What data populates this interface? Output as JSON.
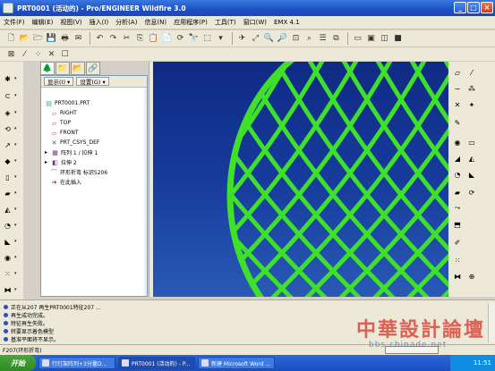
{
  "window": {
    "title": "PRT0001 (活动的) - Pro/ENGINEER Wildfire 3.0",
    "buttons": [
      "minimize",
      "maximize",
      "close"
    ]
  },
  "menu": [
    "文件(F)",
    "编辑(E)",
    "视图(V)",
    "插入(I)",
    "分析(A)",
    "信息(N)",
    "应用程序(P)",
    "工具(T)",
    "窗口(W)",
    "EMX 4.1"
  ],
  "navigator": {
    "show_button": "显示(I) ▾",
    "settings_button": "设置(G) ▾",
    "tree": [
      {
        "label": "PRT0001.PRT",
        "icon": "part-icon",
        "level": 0
      },
      {
        "label": "RIGHT",
        "icon": "datum-plane-icon",
        "level": 1
      },
      {
        "label": "TOP",
        "icon": "datum-plane-icon",
        "level": 1
      },
      {
        "label": "FRONT",
        "icon": "datum-plane-icon",
        "level": 1
      },
      {
        "label": "PRT_CSYS_DEF",
        "icon": "csys-icon",
        "level": 1
      },
      {
        "label": "阵列 1 / 拉伸 1",
        "icon": "pattern-icon",
        "level": 1,
        "expandable": true
      },
      {
        "label": "拉伸 2",
        "icon": "extrude-icon",
        "level": 1,
        "expandable": true
      },
      {
        "label": "环形折弯 标识5206",
        "icon": "toroidal-bend-icon",
        "level": 1
      },
      {
        "label": "在此插入",
        "icon": "insert-here-icon",
        "level": 1
      }
    ]
  },
  "messages": [
    {
      "text": "正在从207 再生PRT0001特征207 ...",
      "color": "#2a4fc0"
    },
    {
      "text": "再生成功完成。",
      "color": "#2a4fc0"
    },
    {
      "text": "特征再生失败。",
      "color": "#2a4fc0"
    },
    {
      "text": "转要显示着色模型",
      "color": "#2a4fc0"
    },
    {
      "text": "基准平面将不显示。",
      "color": "#2a4fc0"
    }
  ],
  "status_text": "F207(环形折弯)",
  "watermark": {
    "main": "中華設計論壇",
    "sub": "bbs.chinade.net"
  },
  "taskbar": {
    "start": "开始",
    "tasks": [
      {
        "label": "行灯架阵列+3分量D...",
        "active": false
      },
      {
        "label": "PRT0001 (活动的) - P...",
        "active": true
      },
      {
        "label": "新建 Microsoft Word ...",
        "active": false
      }
    ],
    "clock": "11:51"
  },
  "colors": {
    "mesh": "#3fe02a",
    "viewport_top": "#0f2a83",
    "viewport_bottom": "#2959b6"
  }
}
